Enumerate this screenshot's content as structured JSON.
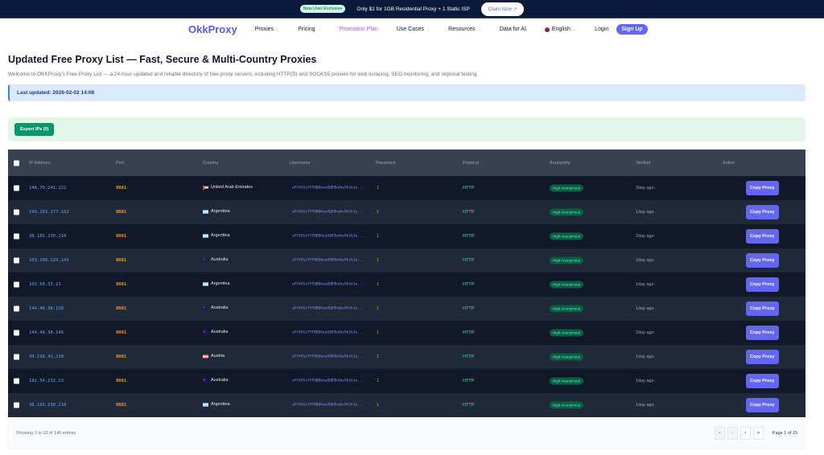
{
  "promo": {
    "badge": "New User Exclusive",
    "text": "Only $1 for 1GB Residential Proxy + 1 Static ISP",
    "cta": "Claim Now ↗"
  },
  "nav": {
    "logo": "OkkProxy",
    "items": [
      "Proxies",
      "Pricing",
      "Promotion Plan",
      "Use Cases",
      "Resources",
      "Data for AI"
    ],
    "language": "English",
    "login": "Login",
    "signup": "Sign Up"
  },
  "page": {
    "title": "Updated Free Proxy List — Fast, Secure & Multi-Country Proxies",
    "description": "Welcome to OKKProxy's Free Proxy List — a 24-hour updated and reliable directory of free proxy servers, including HTTP(S) and SOCKS5 proxies for web scraping, SEO monitoring, and regional testing.",
    "last_updated": "Last updated: 2026-02-02 14:08",
    "export_label": "Export IPs (0)"
  },
  "table": {
    "headers": [
      "IP Address",
      "Port",
      "Country",
      "Username",
      "Password",
      "Protocol",
      "Anonymity",
      "Verified",
      "Action"
    ],
    "rows": [
      {
        "ip": "146.70.241.122",
        "port": "8081",
        "country": "United Arab Emirates",
        "flag": "ae",
        "username": "aFY491o7YF0B0koaXQD9kdke9h1k1e...",
        "password": "1",
        "protocol": "HTTP",
        "anonymity": "High Anonymous",
        "verified": "3day ago",
        "action": "Copy Proxy"
      },
      {
        "ip": "190.103.177.162",
        "port": "8081",
        "country": "Argentina",
        "flag": "ar",
        "username": "aFY491o7YF0B0koaXQD9kdke9h1k1e...",
        "password": "1",
        "protocol": "HTTP",
        "anonymity": "High Anonymous",
        "verified": "1day ago",
        "action": "Copy Proxy"
      },
      {
        "ip": "38.165.230.210",
        "port": "8081",
        "country": "Argentina",
        "flag": "ar",
        "username": "aFY491o7YF0B0koaXQD9kdke9h1k1e...",
        "password": "1",
        "protocol": "HTTP",
        "anonymity": "High Anonymous",
        "verified": "2day ago",
        "action": "Copy Proxy"
      },
      {
        "ip": "103.108.229.143",
        "port": "8081",
        "country": "Australia",
        "flag": "au",
        "username": "aFY491o7YF0B0koaXQD9kdke9h1k1e...",
        "password": "1",
        "protocol": "HTTP",
        "anonymity": "High Anonymous",
        "verified": "2day ago",
        "action": "Copy Proxy"
      },
      {
        "ip": "103.50.33.21",
        "port": "8081",
        "country": "Argentina",
        "flag": "ar",
        "username": "aFY491o7YF0B0koaXQD9kdke9h1k1e...",
        "password": "1",
        "protocol": "HTTP",
        "anonymity": "High Anonymous",
        "verified": "1day ago",
        "action": "Copy Proxy"
      },
      {
        "ip": "144.48.38.138",
        "port": "8081",
        "country": "Australia",
        "flag": "au",
        "username": "aFY491o7YF0B0koaXQD9kdke9h1k1e...",
        "password": "1",
        "protocol": "HTTP",
        "anonymity": "High Anonymous",
        "verified": "1day ago",
        "action": "Copy Proxy"
      },
      {
        "ip": "144.48.38.146",
        "port": "8081",
        "country": "Australia",
        "flag": "au",
        "username": "aFY491o7YF0B0koaXQD9kdke9h1k1e...",
        "password": "1",
        "protocol": "HTTP",
        "anonymity": "High Anonymous",
        "verified": "2day ago",
        "action": "Copy Proxy"
      },
      {
        "ip": "94.198.41.218",
        "port": "8081",
        "country": "Austria",
        "flag": "at",
        "username": "aFY491o7YF0B0koaXQD9kdke9h1k1e...",
        "password": "1",
        "protocol": "HTTP",
        "anonymity": "High Anonymous",
        "verified": "1day ago",
        "action": "Copy Proxy"
      },
      {
        "ip": "182.54.232.23",
        "port": "8081",
        "country": "Australia",
        "flag": "au",
        "username": "aFY491o7YF0B0koaXQD9kdke9h1k1e...",
        "password": "1",
        "protocol": "HTTP",
        "anonymity": "High Anonymous",
        "verified": "1day ago",
        "action": "Copy Proxy"
      },
      {
        "ip": "38.165.230.218",
        "port": "8081",
        "country": "Argentina",
        "flag": "ar",
        "username": "aFY491o7YF0B0koaXQD9kdke9h1k1e...",
        "password": "1",
        "protocol": "HTTP",
        "anonymity": "High Anonymous",
        "verified": "1day ago",
        "action": "Copy Proxy"
      }
    ]
  },
  "pagination": {
    "info": "Showing 1 to 10 of 146 entries",
    "first": "«",
    "prev": "‹",
    "next": "›",
    "last": "»",
    "page_info": "Page 1 of 15"
  },
  "colors": {
    "accent": "#6366f1",
    "row_dark": "#111827",
    "row_light": "#1f2937",
    "header": "#374151",
    "success": "#059669"
  }
}
